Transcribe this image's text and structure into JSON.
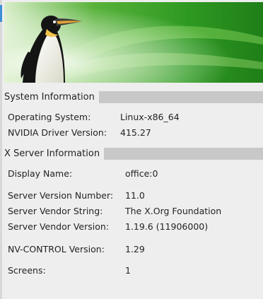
{
  "banner": {
    "image": "penguin-on-green-banner"
  },
  "system_info": {
    "title": "System Information",
    "rows": [
      {
        "label": "Operating System:",
        "value": "Linux-x86_64"
      },
      {
        "label": "NVIDIA Driver Version:",
        "value": "415.27"
      }
    ]
  },
  "x_server_info": {
    "title": "X Server Information",
    "rows": [
      {
        "label": "Display Name:",
        "value": "office:0"
      },
      {
        "label": "Server Version Number:",
        "value": "11.0"
      },
      {
        "label": "Server Vendor String:",
        "value": "The X.Org Foundation"
      },
      {
        "label": "Server Vendor Version:",
        "value": "1.19.6 (11906000)"
      },
      {
        "label": "NV-CONTROL Version:",
        "value": "1.29"
      },
      {
        "label": "Screens:",
        "value": "1"
      }
    ]
  },
  "colors": {
    "background": "#eeeeee",
    "section_bar": "#c8c8c8",
    "accent": "#3d8fd6",
    "banner_green": "#3aa82a"
  }
}
